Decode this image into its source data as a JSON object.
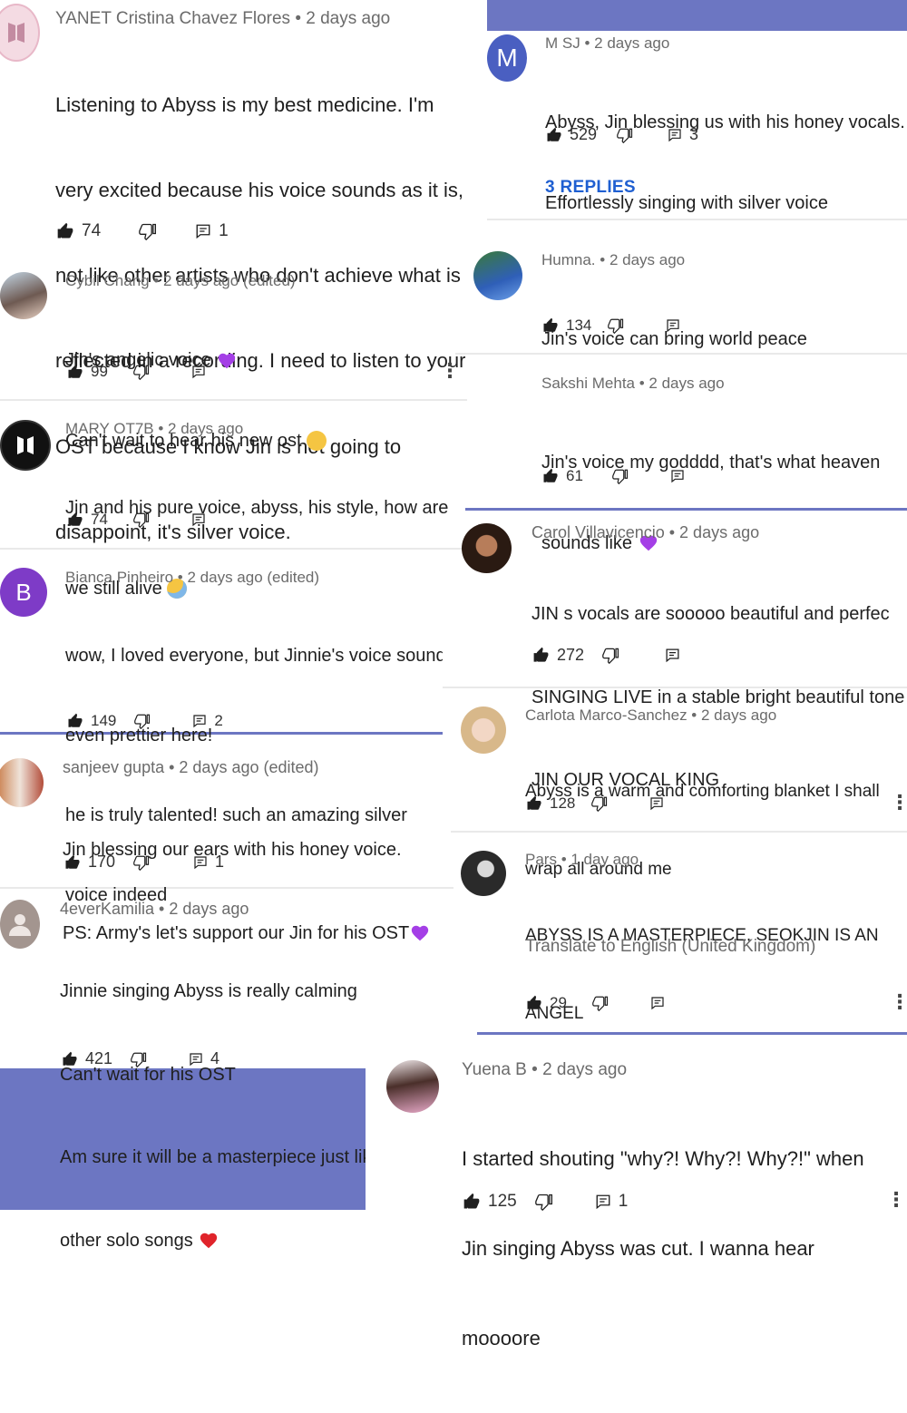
{
  "theme": {
    "accent": "#6c76c2",
    "reply_blue": "#1f5fd1",
    "heart_purple": "#a43fe6",
    "heart_red": "#e0242b"
  },
  "comments": [
    {
      "author": "YANET Cristina Chavez Flores",
      "time": "2 days ago",
      "lines": [
        "Listening to Abyss is my best medicine. I'm",
        "very excited because his voice sounds as it is,",
        "not like other artists who don't achieve what is",
        "reflected in a recording. I need to listen to your",
        "OST because I know Jin is not going to",
        "disappoint, it's silver voice."
      ],
      "likes": "74",
      "replies": "1"
    },
    {
      "author": "M SJ",
      "time": "2 days ago",
      "avatar_letter": "M",
      "lines": [
        "Abyss, Jin blessing us with his honey vocals.",
        "Effortlessly singing with silver voice"
      ],
      "likes": "529",
      "replies": "3",
      "replies_link": "3 REPLIES"
    },
    {
      "author": "Cybil Chang",
      "time": "2 days ago (edited)",
      "lines": [
        "Jin's angelic voice",
        "Can't wait to hear his new ost"
      ],
      "likes": "99"
    },
    {
      "author": "Humna.",
      "time": "2 days ago",
      "lines": [
        "Jin's voice can bring world peace"
      ],
      "likes": "134"
    },
    {
      "author": "Sakshi Mehta",
      "time": "2 days ago",
      "lines": [
        "Jin's voice my godddd, that's what heaven",
        "sounds like"
      ],
      "likes": "61"
    },
    {
      "author": "MARY OT7B",
      "time": "2 days ago",
      "lines": [
        "Jin and his pure voice,  abyss, his style, how are",
        "we still alive"
      ],
      "likes": "74"
    },
    {
      "author": "Carol Villavicencio",
      "time": "2 days ago",
      "lines": [
        "JIN s vocals are sooooo beautiful and perfec",
        "SINGING LIVE in a stable bright beautiful tone",
        "JIN OUR VOCAL KING"
      ],
      "likes": "272"
    },
    {
      "author": "Bianca Pinheiro",
      "time": "2 days ago (edited)",
      "avatar_letter": "B",
      "lines": [
        "wow, I loved everyone, but Jinnie's voice sounds",
        "even prettier here!",
        "he is truly talented! such an amazing silver",
        "voice indeed"
      ],
      "likes": "149",
      "replies": "2"
    },
    {
      "author": "Carlota Marco-Sanchez",
      "time": "2 days ago",
      "lines": [
        "Abyss is a warm and comforting blanket I shall",
        "wrap all around me"
      ],
      "likes": "128"
    },
    {
      "author": "sanjeev gupta",
      "time": "2 days ago (edited)",
      "lines": [
        "Jin blessing our ears with his honey voice.",
        "PS: Army's let's support our Jin for his OST"
      ],
      "likes": "170",
      "replies": "1"
    },
    {
      "author": "Pars",
      "time": "1 day ago",
      "lines": [
        "ABYSS IS A MASTERPIECE, SEOKJIN IS AN",
        "ANGEL"
      ],
      "translate": "Translate to English (United Kingdom)",
      "likes": "29"
    },
    {
      "author": "4everKamilia",
      "time": "2 days ago",
      "lines": [
        "Jinnie singing Abyss is really calming",
        "Can't wait for his OST",
        "Am sure it will be a masterpiece just like his",
        "other solo songs"
      ],
      "likes": "421",
      "replies": "4"
    },
    {
      "author": "Yuena B",
      "time": "2 days ago",
      "lines": [
        "I started shouting \"why?! Why?! Why?!\" when",
        "Jin singing Abyss was cut. I wanna hear",
        "moooore"
      ],
      "likes": "125",
      "replies": "1"
    }
  ],
  "icons": {
    "like": "thumbs-up-icon",
    "dislike": "thumbs-down-icon",
    "reply": "reply-icon",
    "more": "more-vert-icon"
  },
  "sep": " • "
}
